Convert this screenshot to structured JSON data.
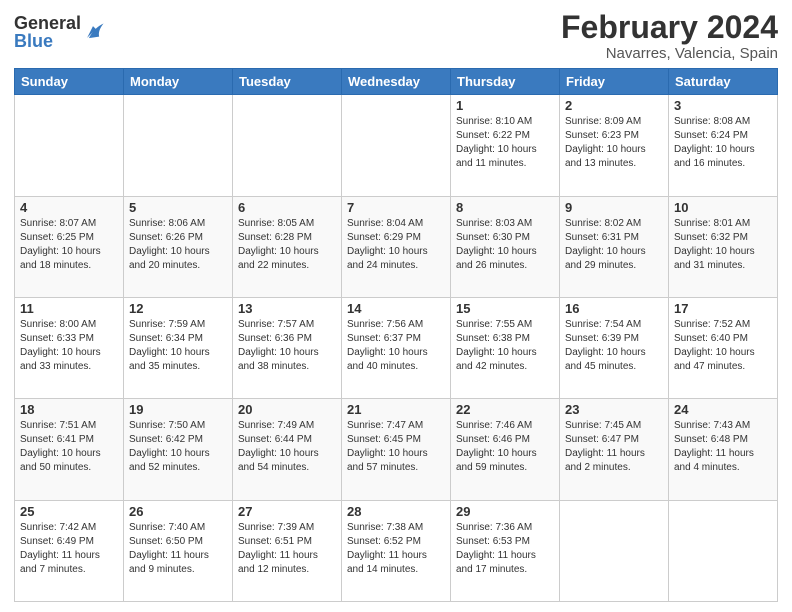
{
  "header": {
    "logo_general": "General",
    "logo_blue": "Blue",
    "title": "February 2024",
    "subtitle": "Navarres, Valencia, Spain"
  },
  "weekdays": [
    "Sunday",
    "Monday",
    "Tuesday",
    "Wednesday",
    "Thursday",
    "Friday",
    "Saturday"
  ],
  "weeks": [
    [
      {
        "day": "",
        "info": ""
      },
      {
        "day": "",
        "info": ""
      },
      {
        "day": "",
        "info": ""
      },
      {
        "day": "",
        "info": ""
      },
      {
        "day": "1",
        "info": "Sunrise: 8:10 AM\nSunset: 6:22 PM\nDaylight: 10 hours\nand 11 minutes."
      },
      {
        "day": "2",
        "info": "Sunrise: 8:09 AM\nSunset: 6:23 PM\nDaylight: 10 hours\nand 13 minutes."
      },
      {
        "day": "3",
        "info": "Sunrise: 8:08 AM\nSunset: 6:24 PM\nDaylight: 10 hours\nand 16 minutes."
      }
    ],
    [
      {
        "day": "4",
        "info": "Sunrise: 8:07 AM\nSunset: 6:25 PM\nDaylight: 10 hours\nand 18 minutes."
      },
      {
        "day": "5",
        "info": "Sunrise: 8:06 AM\nSunset: 6:26 PM\nDaylight: 10 hours\nand 20 minutes."
      },
      {
        "day": "6",
        "info": "Sunrise: 8:05 AM\nSunset: 6:28 PM\nDaylight: 10 hours\nand 22 minutes."
      },
      {
        "day": "7",
        "info": "Sunrise: 8:04 AM\nSunset: 6:29 PM\nDaylight: 10 hours\nand 24 minutes."
      },
      {
        "day": "8",
        "info": "Sunrise: 8:03 AM\nSunset: 6:30 PM\nDaylight: 10 hours\nand 26 minutes."
      },
      {
        "day": "9",
        "info": "Sunrise: 8:02 AM\nSunset: 6:31 PM\nDaylight: 10 hours\nand 29 minutes."
      },
      {
        "day": "10",
        "info": "Sunrise: 8:01 AM\nSunset: 6:32 PM\nDaylight: 10 hours\nand 31 minutes."
      }
    ],
    [
      {
        "day": "11",
        "info": "Sunrise: 8:00 AM\nSunset: 6:33 PM\nDaylight: 10 hours\nand 33 minutes."
      },
      {
        "day": "12",
        "info": "Sunrise: 7:59 AM\nSunset: 6:34 PM\nDaylight: 10 hours\nand 35 minutes."
      },
      {
        "day": "13",
        "info": "Sunrise: 7:57 AM\nSunset: 6:36 PM\nDaylight: 10 hours\nand 38 minutes."
      },
      {
        "day": "14",
        "info": "Sunrise: 7:56 AM\nSunset: 6:37 PM\nDaylight: 10 hours\nand 40 minutes."
      },
      {
        "day": "15",
        "info": "Sunrise: 7:55 AM\nSunset: 6:38 PM\nDaylight: 10 hours\nand 42 minutes."
      },
      {
        "day": "16",
        "info": "Sunrise: 7:54 AM\nSunset: 6:39 PM\nDaylight: 10 hours\nand 45 minutes."
      },
      {
        "day": "17",
        "info": "Sunrise: 7:52 AM\nSunset: 6:40 PM\nDaylight: 10 hours\nand 47 minutes."
      }
    ],
    [
      {
        "day": "18",
        "info": "Sunrise: 7:51 AM\nSunset: 6:41 PM\nDaylight: 10 hours\nand 50 minutes."
      },
      {
        "day": "19",
        "info": "Sunrise: 7:50 AM\nSunset: 6:42 PM\nDaylight: 10 hours\nand 52 minutes."
      },
      {
        "day": "20",
        "info": "Sunrise: 7:49 AM\nSunset: 6:44 PM\nDaylight: 10 hours\nand 54 minutes."
      },
      {
        "day": "21",
        "info": "Sunrise: 7:47 AM\nSunset: 6:45 PM\nDaylight: 10 hours\nand 57 minutes."
      },
      {
        "day": "22",
        "info": "Sunrise: 7:46 AM\nSunset: 6:46 PM\nDaylight: 10 hours\nand 59 minutes."
      },
      {
        "day": "23",
        "info": "Sunrise: 7:45 AM\nSunset: 6:47 PM\nDaylight: 11 hours\nand 2 minutes."
      },
      {
        "day": "24",
        "info": "Sunrise: 7:43 AM\nSunset: 6:48 PM\nDaylight: 11 hours\nand 4 minutes."
      }
    ],
    [
      {
        "day": "25",
        "info": "Sunrise: 7:42 AM\nSunset: 6:49 PM\nDaylight: 11 hours\nand 7 minutes."
      },
      {
        "day": "26",
        "info": "Sunrise: 7:40 AM\nSunset: 6:50 PM\nDaylight: 11 hours\nand 9 minutes."
      },
      {
        "day": "27",
        "info": "Sunrise: 7:39 AM\nSunset: 6:51 PM\nDaylight: 11 hours\nand 12 minutes."
      },
      {
        "day": "28",
        "info": "Sunrise: 7:38 AM\nSunset: 6:52 PM\nDaylight: 11 hours\nand 14 minutes."
      },
      {
        "day": "29",
        "info": "Sunrise: 7:36 AM\nSunset: 6:53 PM\nDaylight: 11 hours\nand 17 minutes."
      },
      {
        "day": "",
        "info": ""
      },
      {
        "day": "",
        "info": ""
      }
    ]
  ]
}
